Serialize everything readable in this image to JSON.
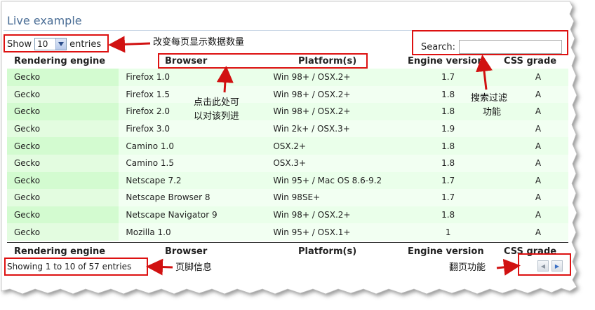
{
  "title": "Live example",
  "controls": {
    "show_label": "Show",
    "page_size": "10",
    "entries_label": "entries",
    "search_label": "Search:",
    "search_value": ""
  },
  "columns": [
    "Rendering engine",
    "Browser",
    "Platform(s)",
    "Engine version",
    "CSS grade"
  ],
  "rows": [
    [
      "Gecko",
      "Firefox 1.0",
      "Win 98+ / OSX.2+",
      "1.7",
      "A"
    ],
    [
      "Gecko",
      "Firefox 1.5",
      "Win 98+ / OSX.2+",
      "1.8",
      "A"
    ],
    [
      "Gecko",
      "Firefox 2.0",
      "Win 98+ / OSX.2+",
      "1.8",
      "A"
    ],
    [
      "Gecko",
      "Firefox 3.0",
      "Win 2k+ / OSX.3+",
      "1.9",
      "A"
    ],
    [
      "Gecko",
      "Camino 1.0",
      "OSX.2+",
      "1.8",
      "A"
    ],
    [
      "Gecko",
      "Camino 1.5",
      "OSX.3+",
      "1.8",
      "A"
    ],
    [
      "Gecko",
      "Netscape 7.2",
      "Win 95+ / Mac OS 8.6-9.2",
      "1.7",
      "A"
    ],
    [
      "Gecko",
      "Netscape Browser 8",
      "Win 98SE+",
      "1.7",
      "A"
    ],
    [
      "Gecko",
      "Netscape Navigator 9",
      "Win 98+ / OSX.2+",
      "1.8",
      "A"
    ],
    [
      "Gecko",
      "Mozilla 1.0",
      "Win 95+ / OSX.1+",
      "1",
      "A"
    ]
  ],
  "footer": {
    "info": "Showing 1 to 10 of 57 entries",
    "prev_glyph": "◀",
    "next_glyph": "▶"
  },
  "annotations": {
    "page_size_note": "改变每页显示数据数量",
    "sort_note_1": "点击此处可",
    "sort_note_2": "以对该列进",
    "search_note_1": "搜索过滤",
    "search_note_2": "功能",
    "info_note": "页脚信息",
    "pager_note": "翻页功能"
  },
  "colors": {
    "annotation_red": "#d11111",
    "title_blue": "#4b6e96",
    "row_green": "#eaffea",
    "sorted_col_green": "#d3fbd0"
  }
}
